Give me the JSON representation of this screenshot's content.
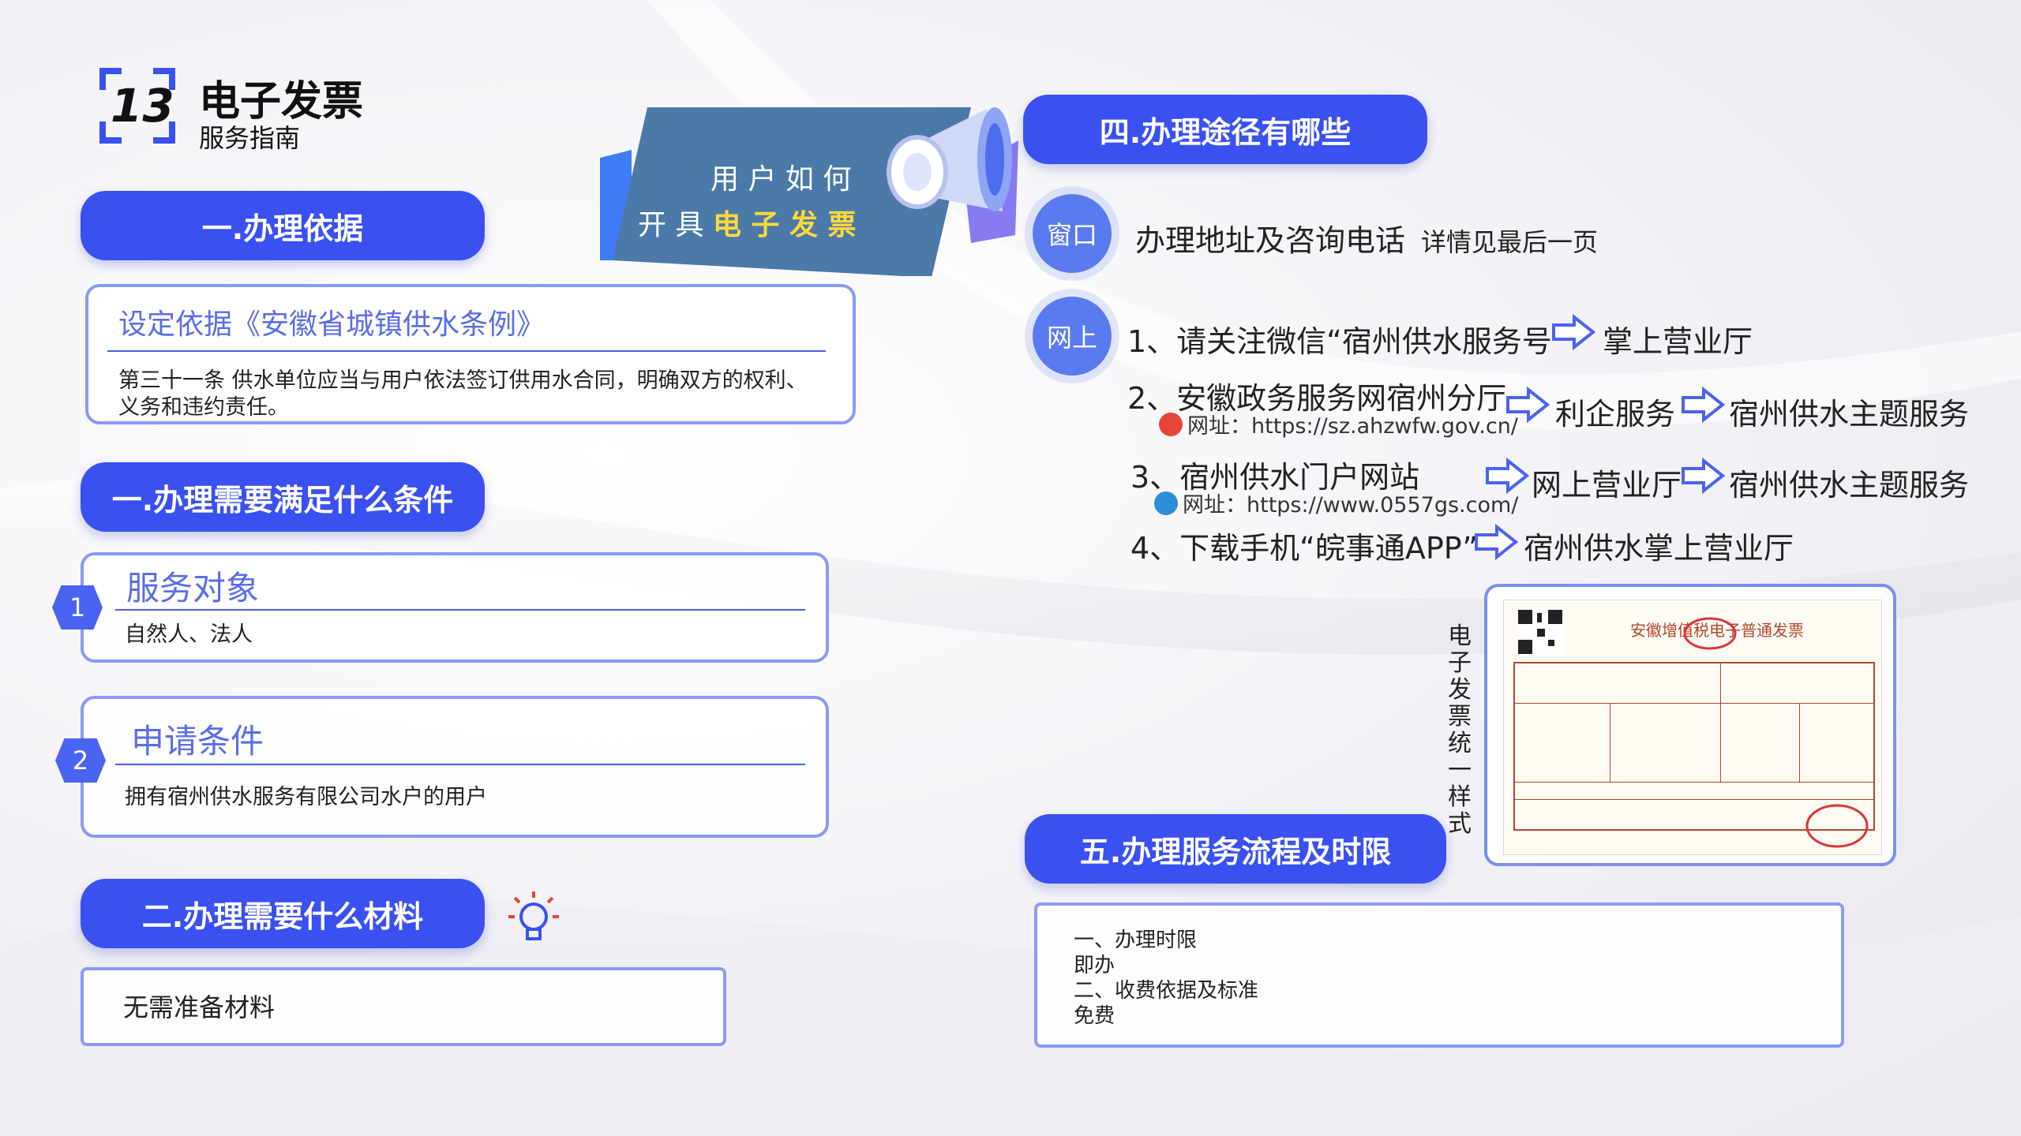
{
  "colors": {
    "primary": "#3a50f0",
    "border": "#8a9af5",
    "title": "#5a6ee8",
    "accent_yellow": "#ffd93b"
  },
  "header": {
    "logo_text": "13",
    "title": "电子发票",
    "subtitle": "服务指南"
  },
  "banner": {
    "line1": "用 户 如 何",
    "line2_prefix": "开 具 ",
    "line2_highlight": "电 子 发 票"
  },
  "sections": {
    "s1": {
      "label": "一.办理依据"
    },
    "basis": {
      "title": "设定依据《安徽省城镇供水条例》",
      "text_line1": "第三十一条 供水单位应当与用户依法签订供用水合同，明确双方的权利、",
      "text_line2": "义务和违约责任。"
    },
    "s2": {
      "label": "一.办理需要满足什么条件"
    },
    "cond1": {
      "num": "1",
      "title": "服务对象",
      "text": "自然人、法人"
    },
    "cond2": {
      "num": "2",
      "title": "申请条件",
      "text": "拥有宿州供水服务有限公司水户的用户"
    },
    "s3": {
      "label": "二.办理需要什么材料"
    },
    "materials": {
      "text": "无需准备材料"
    },
    "s4": {
      "label": "四.办理途径有哪些"
    },
    "window": {
      "badge": "窗口",
      "main": "办理地址及咨询电话",
      "sub": "详情见最后一页"
    },
    "online": {
      "badge": "网上",
      "item1": {
        "text": "1、请关注微信“宿州供水服务号”",
        "target": "掌上营业厅"
      },
      "item2": {
        "text": "2、安徽政务服务网宿州分厅",
        "url": "网址：https://sz.ahzwfw.gov.cn/",
        "target1": "利企服务",
        "target2": "宿州供水主题服务"
      },
      "item3": {
        "text": "3、宿州供水门户网站",
        "url": "网址：https://www.0557gs.com/",
        "target1": "网上营业厅",
        "target2": "宿州供水主题服务"
      },
      "item4": {
        "text": "4、下载手机“皖事通APP”",
        "target": "宿州供水掌上营业厅"
      }
    },
    "invoice": {
      "caption": "电子发票统一样式",
      "title": "安徽增值税电子普通发票"
    },
    "s5": {
      "label": "五.办理服务流程及时限"
    },
    "process": {
      "line1": "一、办理时限",
      "line2": "即办",
      "line3": "二、收费依据及标准",
      "line4": "免费"
    }
  }
}
